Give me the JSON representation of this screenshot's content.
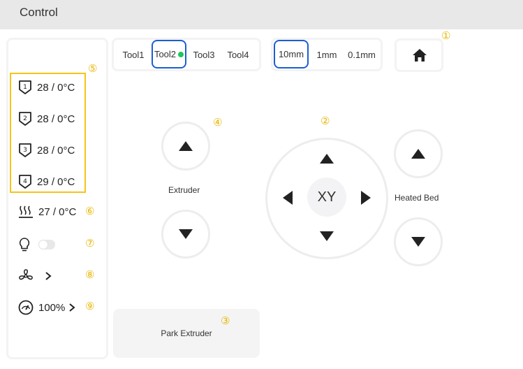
{
  "header": {
    "title": "Control"
  },
  "extruders": [
    {
      "index": "1",
      "temp": "28 / 0°C"
    },
    {
      "index": "2",
      "temp": "28 / 0°C"
    },
    {
      "index": "3",
      "temp": "28 / 0°C"
    },
    {
      "index": "4",
      "temp": "29 / 0°C"
    }
  ],
  "heated_bed": {
    "temp": "27 / 0°C"
  },
  "fan_speed": {
    "value": "100%"
  },
  "light": {
    "on": false
  },
  "tools": {
    "items": [
      "Tool1",
      "Tool2",
      "Tool3",
      "Tool4"
    ],
    "active": "Tool2"
  },
  "step": {
    "items": [
      "10mm",
      "1mm",
      "0.1mm"
    ],
    "active": "10mm"
  },
  "labels": {
    "extruder": "Extruder",
    "heated_bed": "Heated Bed",
    "xy": "XY",
    "park": "Park Extruder"
  },
  "markers": [
    "①",
    "②",
    "③",
    "④",
    "⑤",
    "⑥",
    "⑦",
    "⑧",
    "⑨"
  ],
  "colors": {
    "accent": "#1a5fd1",
    "marker": "#e8b600",
    "active_dot": "#22c55e",
    "highlight_border": "#f5c518"
  }
}
